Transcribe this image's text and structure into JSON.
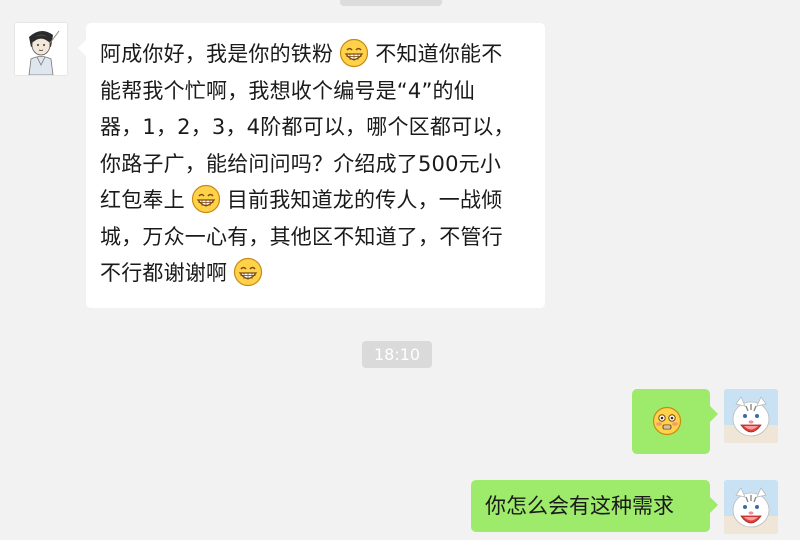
{
  "incoming_message": {
    "segments": [
      {
        "type": "text",
        "value": "阿成你好，我是你的铁粉"
      },
      {
        "type": "emoji",
        "name": "grin-emoji"
      },
      {
        "type": "text",
        "value": "不知道你能不能帮我个忙啊，我想收个编号是“4”的仙器，1，2，3，4阶都可以，哪个区都可以，你路子广，能给问问吗？介绍成了500元小红包奉上"
      },
      {
        "type": "emoji",
        "name": "grin-emoji"
      },
      {
        "type": "text",
        "value": "目前我知道龙的传人，一战倾城，万众一心有，其他区不知道了，不管行不行都谢谢啊"
      },
      {
        "type": "emoji",
        "name": "grin-emoji"
      }
    ],
    "lines": [
      [
        "阿成你好，我是你的铁粉",
        "不知道你能不"
      ],
      [
        "能帮我个忙啊，我想收个编号是“4”的仙"
      ],
      [
        "器，1，2，3，4阶都可以，哪个区都可以，"
      ],
      [
        "你路子广，能给问问吗？介绍成了500元小"
      ],
      [
        "红包奉上",
        "目前我知道龙的传人，一战倾"
      ],
      [
        "城，万众一心有，其他区不知道了，不管行"
      ],
      [
        "不行都谢谢啊"
      ]
    ]
  },
  "timestamp": "18:10",
  "outgoing_messages": [
    {
      "type": "emoji",
      "name": "flushed-emoji"
    },
    {
      "type": "text",
      "value": "你怎么会有这种需求"
    }
  ],
  "colors": {
    "background": "#f2f2f2",
    "incoming_bubble": "#ffffff",
    "outgoing_bubble": "#9eea6a",
    "time_badge": "#dadada"
  }
}
